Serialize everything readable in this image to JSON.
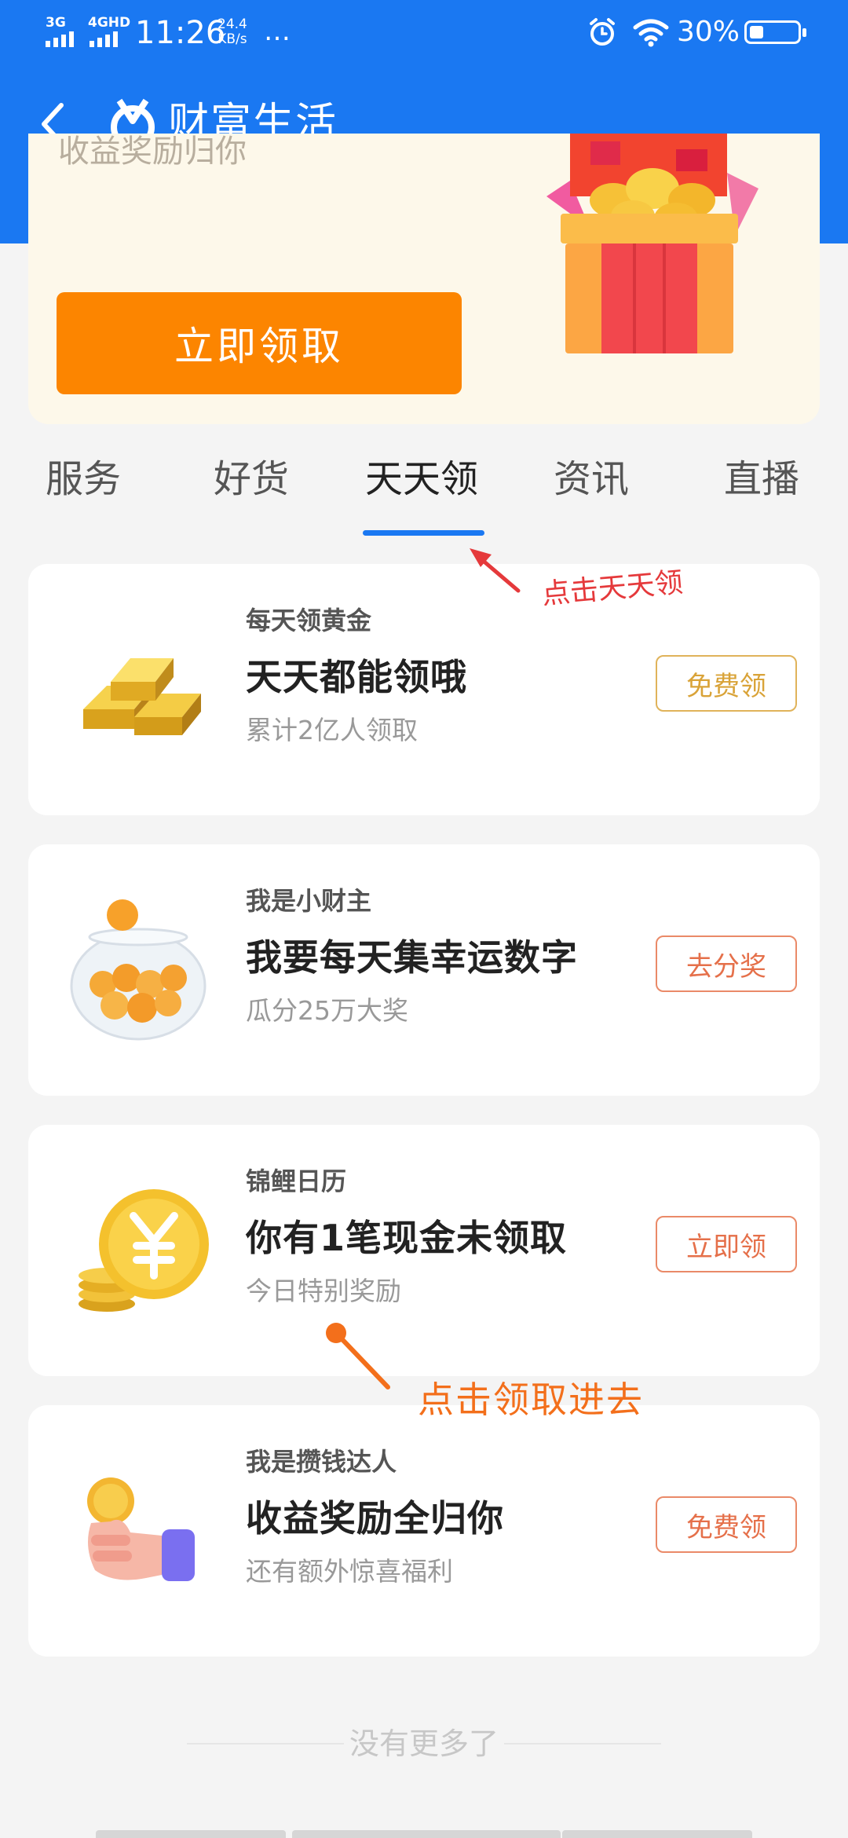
{
  "status_bar": {
    "network_1": "3G",
    "network_2": "4GHD",
    "time": "11:26",
    "speed_value": "24.4",
    "speed_unit": "KB/s",
    "more": "…",
    "battery_percent": "30%",
    "battery_level": 0.3
  },
  "header": {
    "title": "财富生活",
    "back_icon": "chevron-left-icon",
    "logo_icon": "alipay-wealth-logo-icon"
  },
  "banner": {
    "subtitle": "收益奖励归你",
    "button_label": "立即领取",
    "image_icon": "treasure-chest-icon"
  },
  "tabs": [
    {
      "label": "服务",
      "active": false
    },
    {
      "label": "好货",
      "active": false
    },
    {
      "label": "天天领",
      "active": true
    },
    {
      "label": "资讯",
      "active": false
    },
    {
      "label": "直播",
      "active": false
    }
  ],
  "annotations": {
    "tab_hint": "点击天天领",
    "claim_hint": "点击领取进去"
  },
  "cards": [
    {
      "tag": "每天领黄金",
      "headline": "天天都能领哦",
      "desc": "累计2亿人领取",
      "action": "免费领",
      "action_color": "#d9a338",
      "icon": "gold-bars-icon"
    },
    {
      "tag": "我是小财主",
      "headline": "我要每天集幸运数字",
      "desc": "瓜分25万大奖",
      "action": "去分奖",
      "action_color": "#e5704a",
      "icon": "lottery-bowl-icon"
    },
    {
      "tag": "锦鲤日历",
      "headline": "你有1笔现金未领取",
      "desc": "今日特别奖励",
      "action": "立即领",
      "action_color": "#e5704a",
      "icon": "yuan-coin-icon"
    },
    {
      "tag": "我是攒钱达人",
      "headline": "收益奖励全归你",
      "desc": "还有额外惊喜福利",
      "action": "免费领",
      "action_color": "#e5704a",
      "icon": "hand-holding-coin-icon"
    }
  ],
  "footer": {
    "no_more": "没有更多了"
  },
  "colors": {
    "brand_blue": "#1a78f2",
    "banner_button": "#fc8500",
    "annotation_red": "#e5393b",
    "annotation_orange": "#f36f1b"
  }
}
